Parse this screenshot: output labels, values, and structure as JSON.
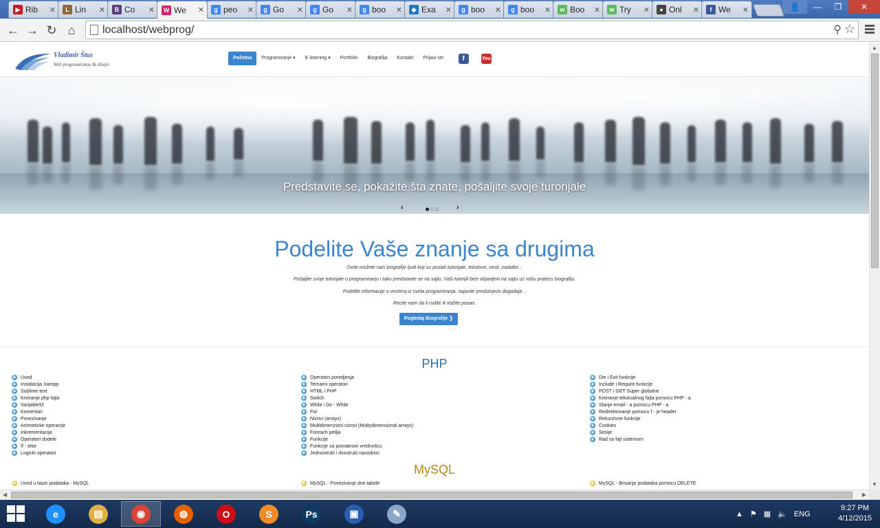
{
  "browser": {
    "tabs": [
      {
        "label": "Rib",
        "icon_color": "#cc181e",
        "icon_text": "▶",
        "active": false
      },
      {
        "label": "Lin",
        "icon_color": "#8b6a3a",
        "icon_text": "L",
        "active": false
      },
      {
        "label": "Co",
        "icon_color": "#563d7c",
        "icon_text": "B",
        "active": false
      },
      {
        "label": "We",
        "icon_color": "#d61f69",
        "icon_text": "W",
        "active": true
      },
      {
        "label": "peo",
        "icon_color": "#4285f4",
        "icon_text": "g",
        "active": false
      },
      {
        "label": "Go",
        "icon_color": "#4285f4",
        "icon_text": "g",
        "active": false
      },
      {
        "label": "Go",
        "icon_color": "#4285f4",
        "icon_text": "g",
        "active": false
      },
      {
        "label": "boo",
        "icon_color": "#4285f4",
        "icon_text": "g",
        "active": false
      },
      {
        "label": "Exa",
        "icon_color": "#1e78c8",
        "icon_text": "◆",
        "active": false
      },
      {
        "label": "boo",
        "icon_color": "#4285f4",
        "icon_text": "g",
        "active": false
      },
      {
        "label": "boo",
        "icon_color": "#4285f4",
        "icon_text": "g",
        "active": false
      },
      {
        "label": "Boo",
        "icon_color": "#5cb85c",
        "icon_text": "w",
        "active": false
      },
      {
        "label": "Try",
        "icon_color": "#5cb85c",
        "icon_text": "w",
        "active": false
      },
      {
        "label": "Onl",
        "icon_color": "#444444",
        "icon_text": "●",
        "active": false
      },
      {
        "label": "We",
        "icon_color": "#3b5998",
        "icon_text": "f",
        "active": false
      }
    ],
    "url": "localhost/webprog/"
  },
  "site": {
    "logo_name": "Vladimir Štus",
    "logo_tagline": "Web programiranje & dizajn",
    "menu": [
      {
        "label": "Početna",
        "active": true
      },
      {
        "label": "Programiranje ▾",
        "active": false
      },
      {
        "label": "E learning ▾",
        "active": false
      },
      {
        "label": "Portfolio",
        "active": false
      },
      {
        "label": "Biografija",
        "active": false
      },
      {
        "label": "Kontakt",
        "active": false
      },
      {
        "label": "Prijavi se!",
        "active": false
      }
    ],
    "social": {
      "facebook": "f",
      "youtube": "You"
    }
  },
  "hero": {
    "caption": "Predstavite se, pokažite šta znate, pošaljite svoje turorijale",
    "prev": "‹",
    "next": "›",
    "active_slide": 1,
    "slides": 3
  },
  "jumbotron": {
    "heading": "Podelite Vaše znanje sa drugima",
    "lines": [
      "Ovde možete naći biografije ljudi koji su poslali tutorijale, tekstove, vesti, zadatke...",
      "Pošaljite svoje tutorijale o programiranju i tako predstavite se na sajtu. Vaši tutorijli biće objavljeni na sajtu uz vašu prateću biografiju.",
      "Podelite informacije o vestima iz sveta programiranja, najavite predstojeće događaje...",
      "Recite nam da li rudite ili tražite posao."
    ],
    "button": "Pogledaj Biografije ❯"
  },
  "php": {
    "title": "PHP",
    "col1": [
      "Uvod",
      "Instalacija Xampp",
      "Sublime text",
      "Kreiranje php fajla",
      "Varijablešš",
      "Komentari",
      "Povezivanje",
      "Aritmeticke operacije",
      "Inkrementacija",
      "Operatori dodele",
      "If - else",
      "Logicki operatori"
    ],
    "col2": [
      "Operatori poredjenja",
      "Ternarni operatori",
      "HTML i PHP",
      "Switch",
      "While i Do - While",
      "For",
      "Nizovi (arrays)",
      "Multidimenzioni nizovi (Multydimensional arrays)",
      "Foreach petlja",
      "Funkcije",
      "Funkcije sa povratnom vrednošcu",
      "Jednostruki i dvostruki navodnici"
    ],
    "col3": [
      "Die i Exit funkcije",
      "Include i Require funkcije",
      "POST i GET Super globalne",
      "Kreiranje tekstualnog fajla pomocu PHP - a",
      "Slanje email - a pomocu PHP - a",
      "Redirektovanje pomocu f - je header",
      "Rekurzivne funkcije",
      "Cookies",
      "Sesije",
      "Rad sa fajl sistemom"
    ]
  },
  "mysql": {
    "title": "MySQL",
    "col1": [
      "Uvod u baze podataka - MySQL"
    ],
    "col2": [
      "MySQL - Povezivanje dve tabele"
    ],
    "col3": [
      "MySQL - Brisanje podataka pomocu DELETE"
    ]
  },
  "taskbar": {
    "language": "ENG",
    "time": "9:27 PM",
    "date": "4/12/2015",
    "apps": [
      {
        "name": "internet-explorer",
        "label": "e",
        "color": "#1e90ff",
        "active": false
      },
      {
        "name": "file-explorer",
        "label": "▤",
        "color": "#e0b040",
        "active": false
      },
      {
        "name": "chrome",
        "label": "◉",
        "color": "#db4437",
        "active": true
      },
      {
        "name": "firefox",
        "label": "◍",
        "color": "#e66000",
        "active": false
      },
      {
        "name": "opera",
        "label": "O",
        "color": "#cc0f16",
        "active": false
      },
      {
        "name": "sublime-text",
        "label": "S",
        "color": "#f08c28",
        "active": false
      },
      {
        "name": "photoshop",
        "label": "Ps",
        "color": "#0c3b63",
        "active": false
      },
      {
        "name": "save-disk",
        "label": "▣",
        "color": "#2a5db0",
        "active": false
      },
      {
        "name": "paint",
        "label": "✎",
        "color": "#8aa6c8",
        "active": false
      }
    ]
  }
}
